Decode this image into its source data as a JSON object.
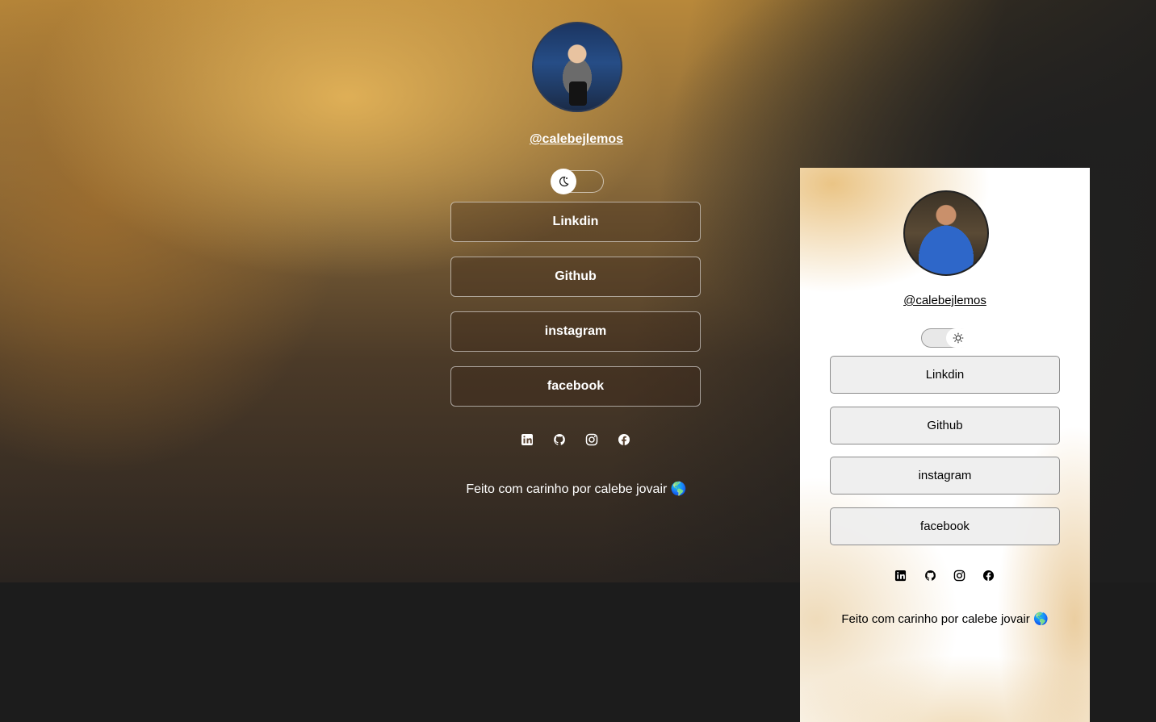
{
  "dark_view": {
    "username": "@calebejlemos",
    "theme_toggle_icon": "moon-icon",
    "links": [
      {
        "label": "Linkdin"
      },
      {
        "label": "Github"
      },
      {
        "label": "instagram"
      },
      {
        "label": "facebook"
      }
    ],
    "social_icons": [
      "linkedin-icon",
      "github-icon",
      "instagram-icon",
      "facebook-icon"
    ],
    "footer": "Feito com carinho por calebe jovair 🌎"
  },
  "light_view": {
    "username": "@calebejlemos",
    "theme_toggle_icon": "sun-icon",
    "links": [
      {
        "label": "Linkdin"
      },
      {
        "label": "Github"
      },
      {
        "label": "instagram"
      },
      {
        "label": "facebook"
      }
    ],
    "social_icons": [
      "linkedin-icon",
      "github-icon",
      "instagram-icon",
      "facebook-icon"
    ],
    "footer": "Feito com carinho por calebe jovair 🌎"
  },
  "colors": {
    "dark_bg": "#1c1c1c",
    "gold_accent": "#e2b258",
    "light_card_bg": "#ffffff"
  }
}
